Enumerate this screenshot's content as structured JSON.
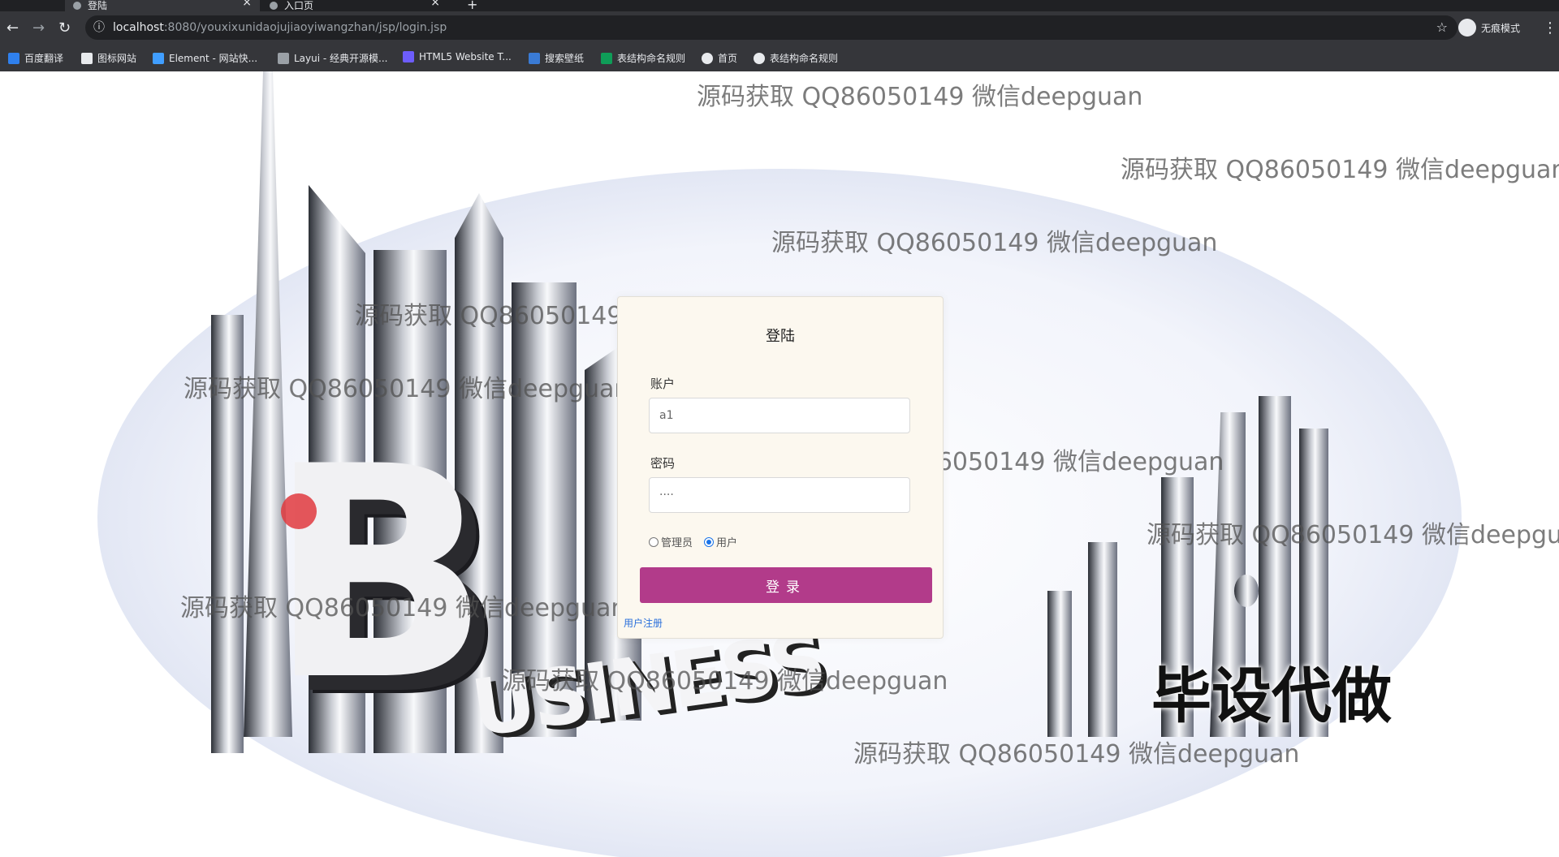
{
  "browser": {
    "tabs": [
      {
        "title": "登陆",
        "active": true
      },
      {
        "title": "入口页",
        "active": false
      }
    ],
    "new_tab": "+",
    "close": "×",
    "url_host": "localhost",
    "url_rest": ":8080/youxixunidaojujiaoyiwangzhan/jsp/login.jsp",
    "profile_label": "无痕模式",
    "bookmarks": [
      {
        "label": "百度翻译",
        "icon": "baidu-translate-icon",
        "color": "#2f80ed"
      },
      {
        "label": "图标网站",
        "icon": "flag-icon",
        "color": "#e8eaed"
      },
      {
        "label": "Element - 网站快...",
        "icon": "element-icon",
        "color": "#409eff"
      },
      {
        "label": "Layui - 经典开源模...",
        "icon": "layui-icon",
        "color": "#9aa0a6"
      },
      {
        "label": "HTML5 Website T...",
        "icon": "html5-icon",
        "color": "#6d5dfc"
      },
      {
        "label": "搜索壁纸",
        "icon": "wallpaper-icon",
        "color": "#3a7bd5"
      },
      {
        "label": "表结构命名规则",
        "icon": "sheet-icon",
        "color": "#0f9d58"
      },
      {
        "label": "首页",
        "icon": "globe-icon",
        "color": "#e8eaed"
      },
      {
        "label": "表结构命名规则",
        "icon": "globe-icon",
        "color": "#e8eaed"
      }
    ]
  },
  "watermark_text": "源码获取 QQ86050149 微信deepguan",
  "background": {
    "big_letter": "B",
    "word": "USINESS",
    "badge": "毕设代做"
  },
  "login": {
    "title": "登陆",
    "account_label": "账户",
    "account_value": "a1",
    "password_label": "密码",
    "password_value": "····",
    "roles": [
      {
        "label": "管理员",
        "checked": false
      },
      {
        "label": "用户",
        "checked": true
      }
    ],
    "submit_label": "登录",
    "register_label": "用户注册"
  },
  "colors": {
    "login_button": "#b23b8a",
    "card_background": "#fcf8ef",
    "link": "#2a6fdb"
  }
}
